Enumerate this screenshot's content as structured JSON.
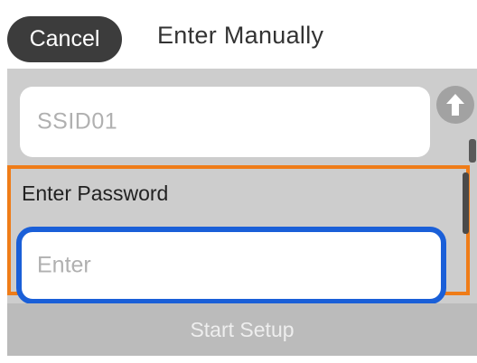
{
  "header": {
    "cancel_label": "Cancel",
    "title": "Enter Manually"
  },
  "form": {
    "ssid_value": "SSID01",
    "password_label": "Enter Password",
    "password_placeholder": "Enter"
  },
  "footer": {
    "start_label": "Start Setup"
  },
  "icons": {
    "up": "up-arrow-icon"
  },
  "colors": {
    "cancel_bg": "#3c3c3c",
    "focus_border": "#1a5fd8",
    "highlight_border": "#ef7c18",
    "panel_bg": "#cdcdcd",
    "disabled_button": "#bbbbbb"
  }
}
